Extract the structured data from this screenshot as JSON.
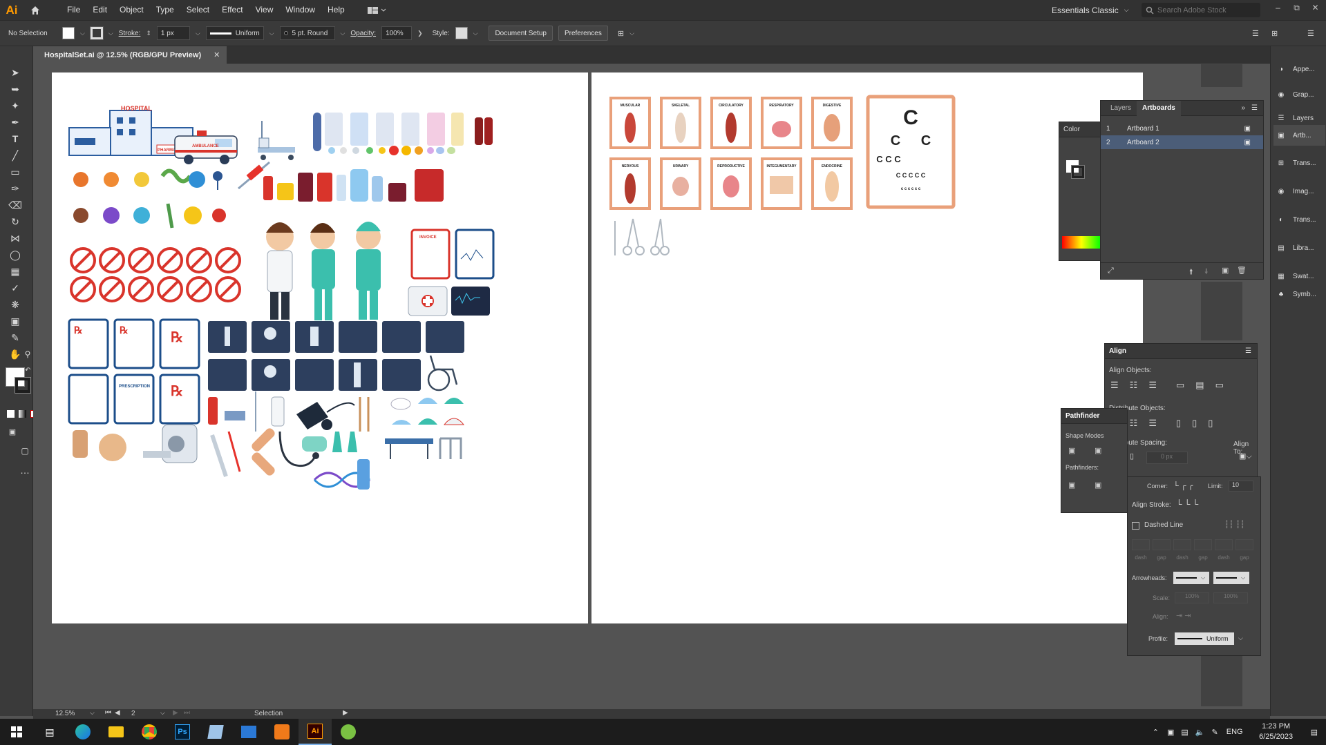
{
  "app": {
    "logo": "Ai",
    "menus": [
      "File",
      "Edit",
      "Object",
      "Type",
      "Select",
      "Effect",
      "View",
      "Window",
      "Help"
    ],
    "workspace": "Essentials Classic",
    "search_placeholder": "Search Adobe Stock"
  },
  "control_bar": {
    "selection": "No Selection",
    "stroke_label": "Stroke:",
    "stroke_weight": "1 px",
    "profile": "Uniform",
    "brush": "5 pt. Round",
    "opacity_label": "Opacity:",
    "opacity_value": "100%",
    "style_label": "Style:",
    "document_setup": "Document Setup",
    "preferences": "Preferences"
  },
  "document": {
    "tab_title": "HospitalSet.ai @ 12.5% (RGB/GPU Preview)"
  },
  "artboard1": {
    "hospital_label": "HOSPITAL",
    "pharmacy_label": "PHARMACY",
    "ambulance_label": "AMBULANCE",
    "invoice_label": "INVOICE",
    "prescription_label": "PRESCRIPTION"
  },
  "artboard2": {
    "charts_row1": [
      "MUSCULAR",
      "SKELETAL",
      "CIRCULATORY",
      "RESPIRATORY",
      "DIGESTIVE"
    ],
    "charts_row2": [
      "NERVOUS",
      "URINARY",
      "REPRODUCTIVE",
      "INTEGUMENTARY",
      "ENDOCRINE"
    ]
  },
  "layers_panel": {
    "tabs": [
      "Layers",
      "Artboards"
    ],
    "artboards": [
      {
        "num": "1",
        "name": "Artboard 1"
      },
      {
        "num": "2",
        "name": "Artboard 2"
      }
    ]
  },
  "color_panel": {
    "title": "Color"
  },
  "align_panel": {
    "title": "Align",
    "align_objects": "Align Objects:",
    "distribute_objects": "Distribute Objects:",
    "distribute_spacing": "Distribute Spacing:",
    "align_to": "Align To:",
    "spacing_value": "0 px"
  },
  "pathfinder_panel": {
    "title": "Pathfinder",
    "shape_modes": "Shape Modes",
    "pathfinders": "Pathfinders:"
  },
  "stroke_panel": {
    "corner": "Corner:",
    "limit": "Limit:",
    "limit_value": "10",
    "align_stroke": "Align Stroke:",
    "dashed_line": "Dashed Line",
    "dash_labels": [
      "dash",
      "gap",
      "dash",
      "gap",
      "dash",
      "gap"
    ],
    "arrowheads": "Arrowheads:",
    "scale": "Scale:",
    "scale_value1": "100%",
    "scale_value2": "100%",
    "align": "Align:",
    "profile": "Profile:",
    "profile_value": "Uniform"
  },
  "dock": [
    "Appe...",
    "Grap...",
    "Layers",
    "Artb...",
    "Trans...",
    "Imag...",
    "Trans...",
    "Libra...",
    "Swat...",
    "Symb..."
  ],
  "status": {
    "zoom": "12.5%",
    "artboard_num": "2",
    "tool": "Selection"
  },
  "taskbar": {
    "language": "ENG",
    "time": "1:23 PM",
    "date": "6/25/2023"
  },
  "colors": {
    "ai_orange": "#ff9a00",
    "chart_frame": "#e9a07a",
    "rx_blue": "#1c4e8a",
    "no_red": "#d9342b"
  }
}
